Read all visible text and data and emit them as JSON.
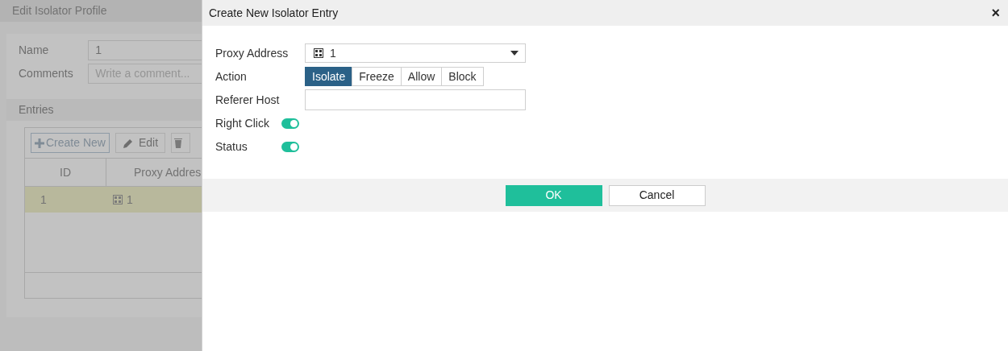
{
  "background": {
    "title": "Edit Isolator Profile",
    "fields": [
      {
        "label": "Name",
        "value": "1"
      },
      {
        "label": "Comments",
        "placeholder": "Write a comment..."
      }
    ],
    "entries": {
      "title": "Entries",
      "toolbar": [
        "Create New",
        "Edit"
      ],
      "columns": [
        "ID",
        "Proxy Addres"
      ],
      "rows": [
        {
          "id": "1",
          "proxy_address": "1",
          "selected": true
        }
      ]
    }
  },
  "dialog": {
    "title": "Create New Isolator Entry",
    "close": "×",
    "proxy_address": {
      "label": "Proxy Address",
      "value": "1"
    },
    "action": {
      "label": "Action",
      "options": [
        {
          "label": "Isolate",
          "selected": true
        },
        {
          "label": "Freeze",
          "selected": false
        },
        {
          "label": "Allow",
          "selected": false
        },
        {
          "label": "Block",
          "selected": false
        }
      ]
    },
    "referer_host": {
      "label": "Referer Host"
    },
    "toggles": [
      {
        "label": "Right Click",
        "on": true
      },
      {
        "label": "Status",
        "on": true
      }
    ],
    "buttons": {
      "ok": "OK",
      "cancel": "Cancel"
    }
  }
}
